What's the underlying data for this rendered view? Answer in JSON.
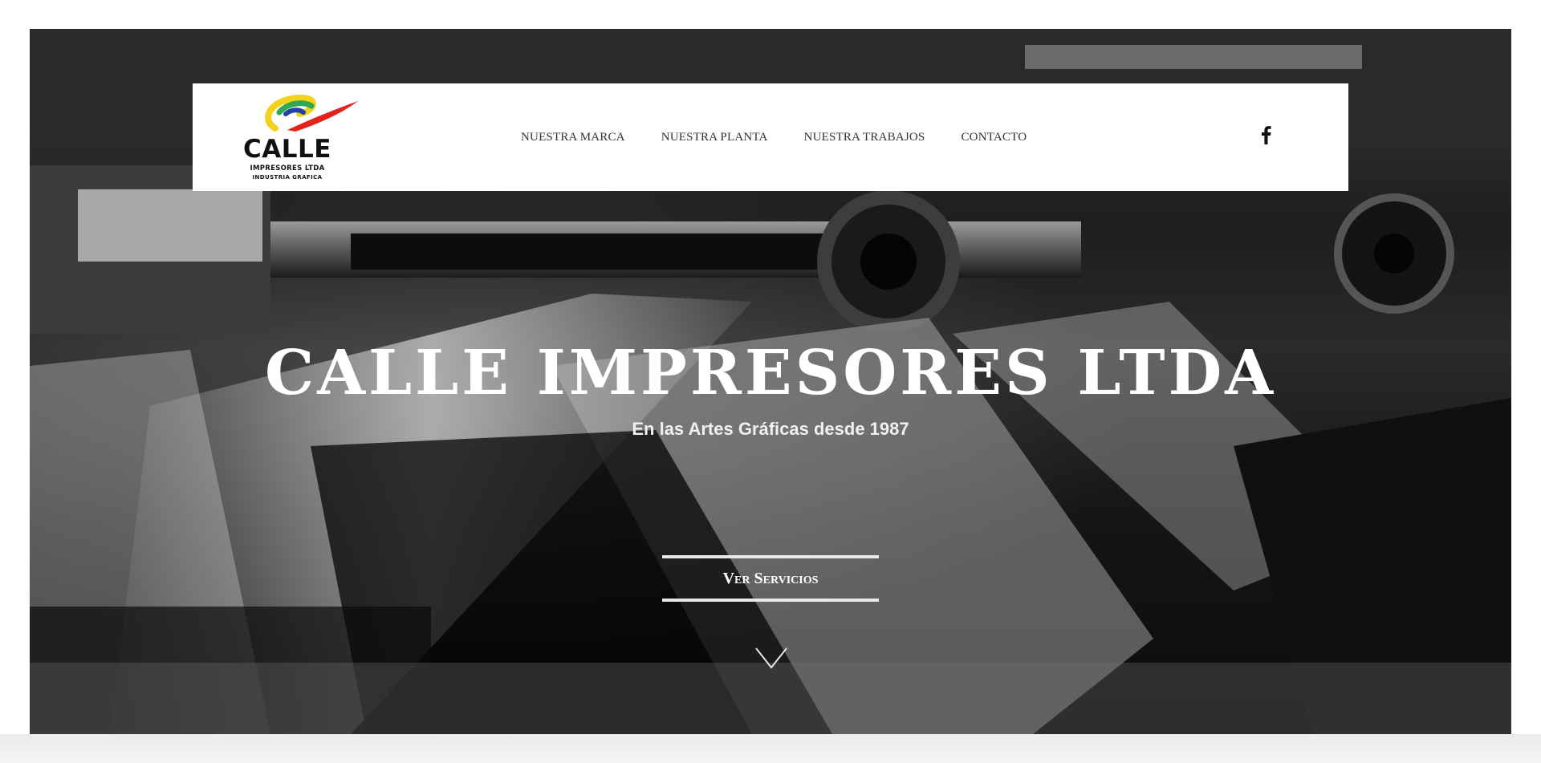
{
  "brand": {
    "logo_name": "CALLE",
    "logo_line1": "IMPRESORES LTDA",
    "logo_line2": "INDUSTRIA GRAFICA"
  },
  "nav": {
    "items": [
      {
        "label": "NUESTRA MARCA"
      },
      {
        "label": "NUESTRA PLANTA"
      },
      {
        "label": "NUESTRA TRABAJOS"
      },
      {
        "label": "CONTACTO"
      }
    ],
    "social_icon": "facebook-icon"
  },
  "hero": {
    "title": "CALLE IMPRESORES LTDA",
    "subtitle": "En las Artes Gráficas desde 1987",
    "cta_label": "Ver Servicios",
    "scroll_icon": "chevron-down-icon"
  },
  "colors": {
    "nav_bg": "#ffffff",
    "hero_text": "#ffffff",
    "menu_text": "#333333"
  }
}
